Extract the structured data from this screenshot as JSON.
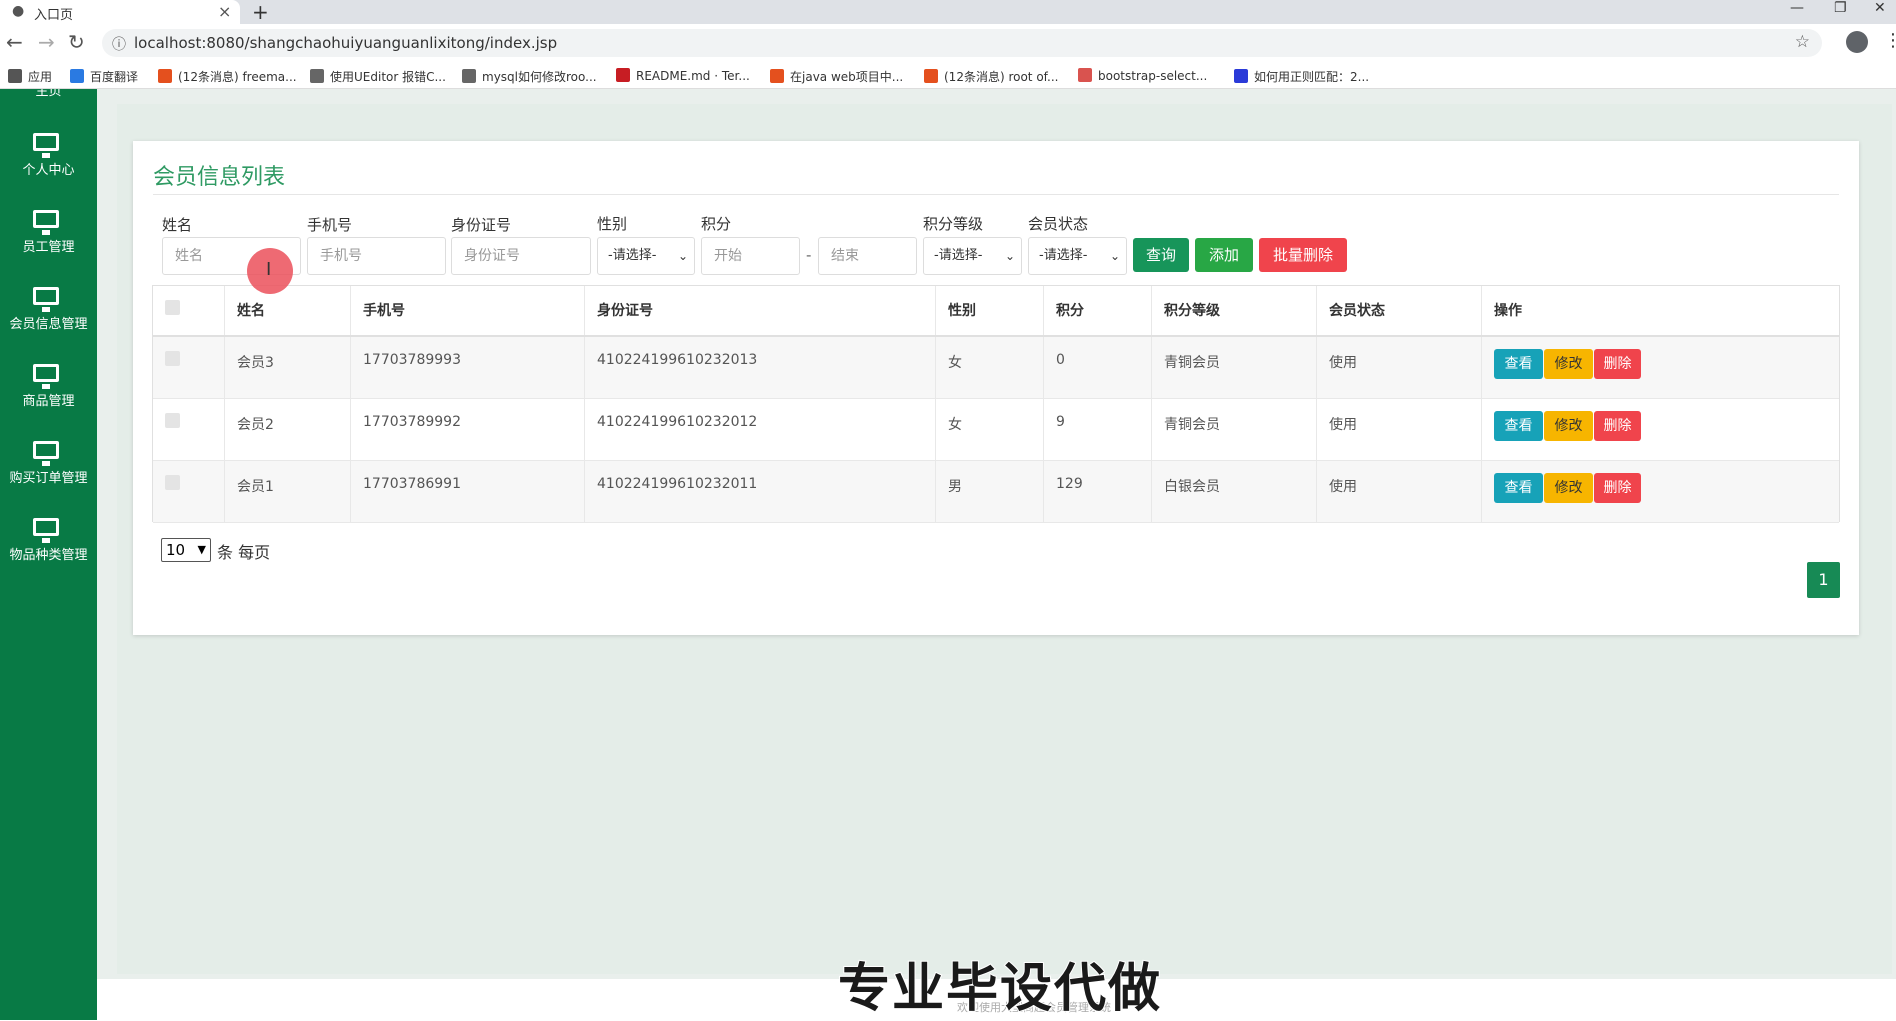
{
  "browser": {
    "tab_title": "入口页",
    "new_tab": "+",
    "url": "localhost:8080/shangchaohuiyuanguanlixitong/index.jsp",
    "bookmarks": [
      {
        "label": "应用",
        "color": "#555"
      },
      {
        "label": "百度翻译",
        "color": "#2a7ae2"
      },
      {
        "label": "(12条消息) freema...",
        "color": "#e4501e"
      },
      {
        "label": "使用UEditor 报错C...",
        "color": "#666"
      },
      {
        "label": "mysql如何修改roo...",
        "color": "#666"
      },
      {
        "label": "README.md · Ter...",
        "color": "#c71d23"
      },
      {
        "label": "在java web项目中...",
        "color": "#e4501e"
      },
      {
        "label": "(12条消息) root of...",
        "color": "#e4501e"
      },
      {
        "label": "bootstrap-select...",
        "color": "#d9534f"
      },
      {
        "label": "如何用正则匹配：2...",
        "color": "#2a3ad8"
      }
    ]
  },
  "sidebar": {
    "top_cut_label": "主页",
    "items": [
      {
        "label": "个人中心"
      },
      {
        "label": "员工管理"
      },
      {
        "label": "会员信息管理"
      },
      {
        "label": "商品管理"
      },
      {
        "label": "购买订单管理"
      },
      {
        "label": "物品种类管理"
      }
    ]
  },
  "page": {
    "title": "会员信息列表",
    "filters": {
      "name_label": "姓名",
      "name_placeholder": "姓名",
      "phone_label": "手机号",
      "phone_placeholder": "手机号",
      "idcard_label": "身份证号",
      "idcard_placeholder": "身份证号",
      "gender_label": "性别",
      "gender_value": "-请选择-",
      "points_label": "积分",
      "points_start": "开始",
      "points_dash": "-",
      "points_end": "结束",
      "level_label": "积分等级",
      "level_value": "-请选择-",
      "status_label": "会员状态",
      "status_value": "-请选择-"
    },
    "buttons": {
      "query": "查询",
      "add": "添加",
      "batch_delete": "批量删除"
    },
    "table": {
      "headers": [
        "姓名",
        "手机号",
        "身份证号",
        "性别",
        "积分",
        "积分等级",
        "会员状态",
        "操作"
      ],
      "rows": [
        [
          "会员3",
          "17703789993",
          "410224199610232013",
          "女",
          "0",
          "青铜会员",
          "使用"
        ],
        [
          "会员2",
          "17703789992",
          "410224199610232012",
          "女",
          "9",
          "青铜会员",
          "使用"
        ],
        [
          "会员1",
          "17703786991",
          "410224199610232011",
          "男",
          "129",
          "白银会员",
          "使用"
        ]
      ],
      "actions": {
        "view": "查看",
        "edit": "修改",
        "delete": "删除"
      }
    },
    "page_size": {
      "value": "10",
      "label": "条 每页"
    },
    "current_page": "1"
  },
  "footer": {
    "text": "欢迎使用大型商超会员管理系统"
  },
  "watermark": "专业毕设代做",
  "colors": {
    "sidebar": "#087a45",
    "accent": "#2f9a63",
    "danger": "#f0444c",
    "warning": "#f7b500",
    "info": "#17a2b8"
  }
}
